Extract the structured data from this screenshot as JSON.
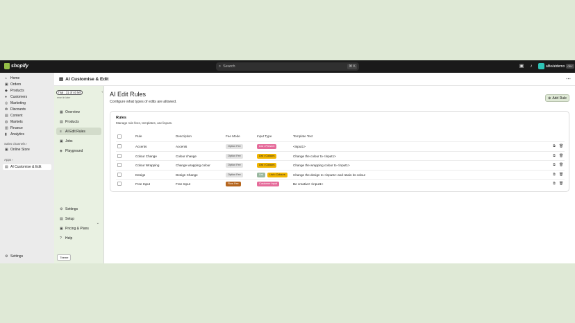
{
  "topbar": {
    "brand": "shopify",
    "search_placeholder": "Search",
    "search_shortcut": "⌘ K",
    "store_name": "alfie/atdemo",
    "store_tag": "dev"
  },
  "sidebar": {
    "items": [
      {
        "label": "Home",
        "icon": "home-icon",
        "glyph": "⌂"
      },
      {
        "label": "Orders",
        "icon": "orders-icon",
        "glyph": "▣"
      },
      {
        "label": "Products",
        "icon": "tag-icon",
        "glyph": "◆"
      },
      {
        "label": "Customers",
        "icon": "person-icon",
        "glyph": "●"
      },
      {
        "label": "Marketing",
        "icon": "target-icon",
        "glyph": "◎"
      },
      {
        "label": "Discounts",
        "icon": "discount-icon",
        "glyph": "✿"
      },
      {
        "label": "Content",
        "icon": "content-icon",
        "glyph": "▤"
      },
      {
        "label": "Markets",
        "icon": "globe-icon",
        "glyph": "◍"
      },
      {
        "label": "Finance",
        "icon": "bank-icon",
        "glyph": "▥"
      },
      {
        "label": "Analytics",
        "icon": "chart-icon",
        "glyph": "▮"
      }
    ],
    "sales_channels_label": "Sales channels ›",
    "online_store_label": "Online Store",
    "apps_label": "Apps ›",
    "app_active_label": "AI Customise & Edit",
    "settings_label": "Settings"
  },
  "app": {
    "title": "AI Customise & Edit",
    "trial": "Trial : 31 of 40 left",
    "trial_sub": "reset in later",
    "nav": [
      {
        "label": "Overview",
        "icon": "overview-icon",
        "glyph": "▦"
      },
      {
        "label": "Products",
        "icon": "products-icon",
        "glyph": "▤"
      },
      {
        "label": "AI Edit Rules",
        "icon": "rules-icon",
        "glyph": "≡"
      },
      {
        "label": "Jobs",
        "icon": "jobs-icon",
        "glyph": "▣"
      },
      {
        "label": "Playground",
        "icon": "playground-icon",
        "glyph": "◈"
      }
    ],
    "nav_bottom": [
      {
        "label": "Settings",
        "icon": "gear-icon",
        "glyph": "⚙"
      },
      {
        "label": "Setup",
        "icon": "setup-icon",
        "glyph": "▤"
      },
      {
        "label": "Pricing & Plans",
        "icon": "pricing-icon",
        "glyph": "▣"
      },
      {
        "label": "Help",
        "icon": "help-icon",
        "glyph": "?"
      }
    ],
    "theme_label": "Theme"
  },
  "page": {
    "title": "AI Edit Rules",
    "subtitle": "Configure what types of edits are allowed.",
    "add_button": "Add Rule",
    "card_title": "Rules",
    "card_subtitle": "Manage rule fees, templates, and inputs.",
    "columns": [
      "Rule",
      "Description",
      "Fee Mode",
      "Input Type",
      "Template Text"
    ],
    "rows": [
      {
        "rule": "Accents",
        "description": "Accents",
        "fee": "Option Fee",
        "fee_color": "#e3e3e3",
        "input": [
          "List • Present"
        ],
        "input_colors": [
          "#e56b9a"
        ],
        "template": "<input1>"
      },
      {
        "rule": "Colour Change",
        "description": "Colour change",
        "fee": "Option Fee",
        "fee_color": "#e3e3e3",
        "input": [
          "List • Colours"
        ],
        "input_colors": [
          "#f0b400"
        ],
        "template": "Change the colour to <input1>"
      },
      {
        "rule": "Colour Wrapping",
        "description": "Change wrapping colour",
        "fee": "Option Fee",
        "fee_color": "#e3e3e3",
        "input": [
          "List • Colours"
        ],
        "input_colors": [
          "#f0b400"
        ],
        "template": "Change the wrapping colour to <input1>"
      },
      {
        "rule": "Design",
        "description": "Design Change",
        "fee": "Option Fee",
        "fee_color": "#e3e3e3",
        "input": [
          "List",
          "List • Colours"
        ],
        "input_colors": [
          "#9ab8a0",
          "#f0b400"
        ],
        "template": "Change the design to <input1> and retain its colour"
      },
      {
        "rule": "Free Input",
        "description": "Free Input",
        "fee": "Flow Fee",
        "fee_color": "#b5651d",
        "input": [
          "Customer Input"
        ],
        "input_colors": [
          "#e56b9a"
        ],
        "template": "Be creative! <input1>"
      }
    ]
  }
}
